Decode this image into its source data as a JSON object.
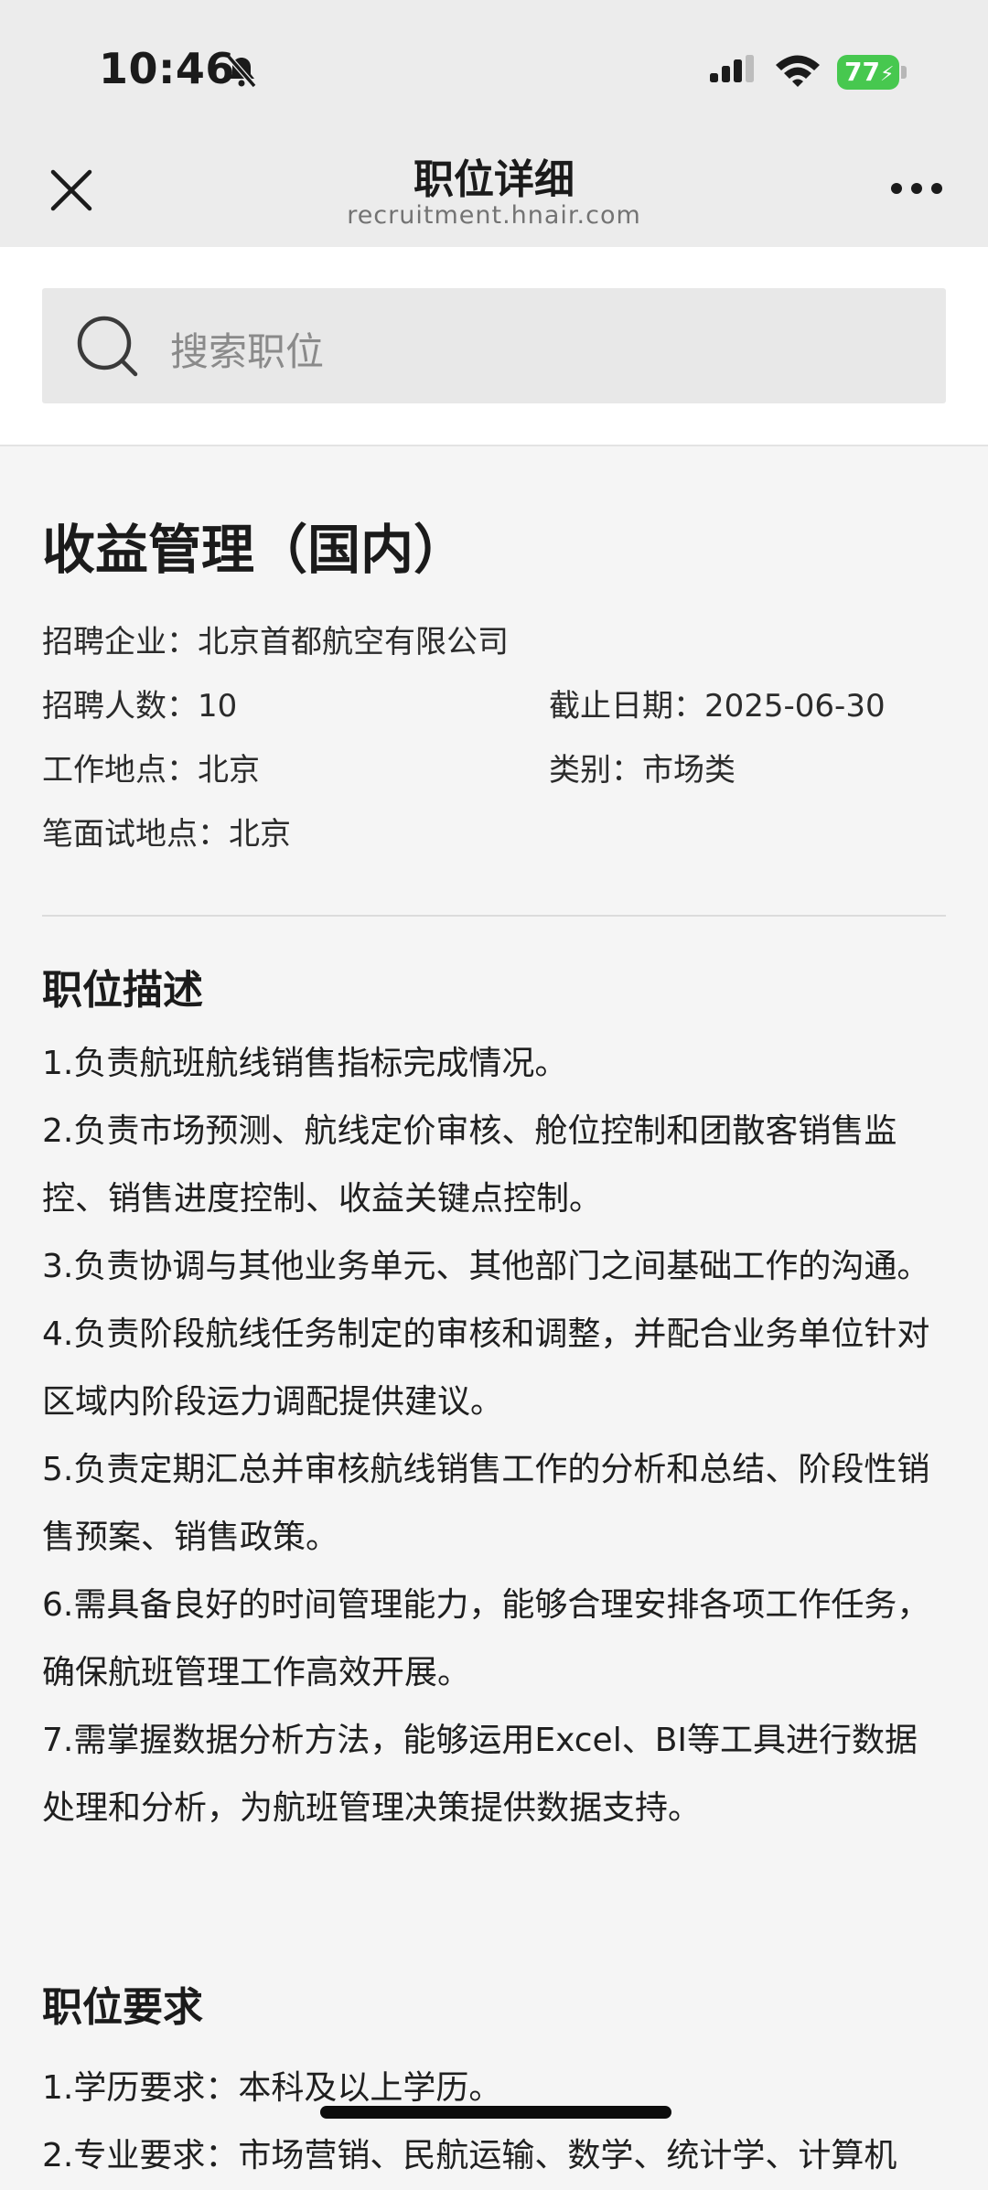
{
  "status_bar": {
    "time": "10:46",
    "battery": "77",
    "icons": [
      "bell-off-icon",
      "signal-icon",
      "wifi-icon",
      "battery-charging-icon"
    ],
    "battery_color": "#47c84f"
  },
  "nav": {
    "title": "职位详细",
    "subtitle": "recruitment.hnair.com",
    "close_icon": "close-icon",
    "more_icon": "more-icon"
  },
  "search": {
    "placeholder": "搜索职位",
    "icon": "search-icon"
  },
  "job": {
    "title": "收益管理（国内）",
    "company": "招聘企业：北京首都航空有限公司",
    "headcount": "招聘人数：10",
    "deadline": "截止日期：2025-06-30",
    "location": "工作地点：北京",
    "category": "类别：市场类",
    "exam_location": "笔面试地点：北京"
  },
  "description": {
    "heading": "职位描述",
    "items": [
      "1.负责航班航线销售指标完成情况。",
      "2.负责市场预测、航线定价审核、舱位控制和团散客销售监控、销售进度控制、收益关键点控制。",
      "3.负责协调与其他业务单元、其他部门之间基础工作的沟通。",
      "4.负责阶段航线任务制定的审核和调整，并配合业务单位针对区域内阶段运力调配提供建议。",
      "5.负责定期汇总并审核航线销售工作的分析和总结、阶段性销售预案、销售政策。",
      "6.需具备良好的时间管理能力，能够合理安排各项工作任务，确保航班管理工作高效开展。",
      "7.需掌握数据分析方法，能够运用Excel、BI等工具进行数据处理和分析，为航班管理决策提供数据支持。"
    ]
  },
  "requirements": {
    "heading": "职位要求",
    "items": [
      "1.学历要求：本科及以上学历。",
      "2.专业要求：市场营销、民航运输、数学、统计学、计算机"
    ]
  }
}
